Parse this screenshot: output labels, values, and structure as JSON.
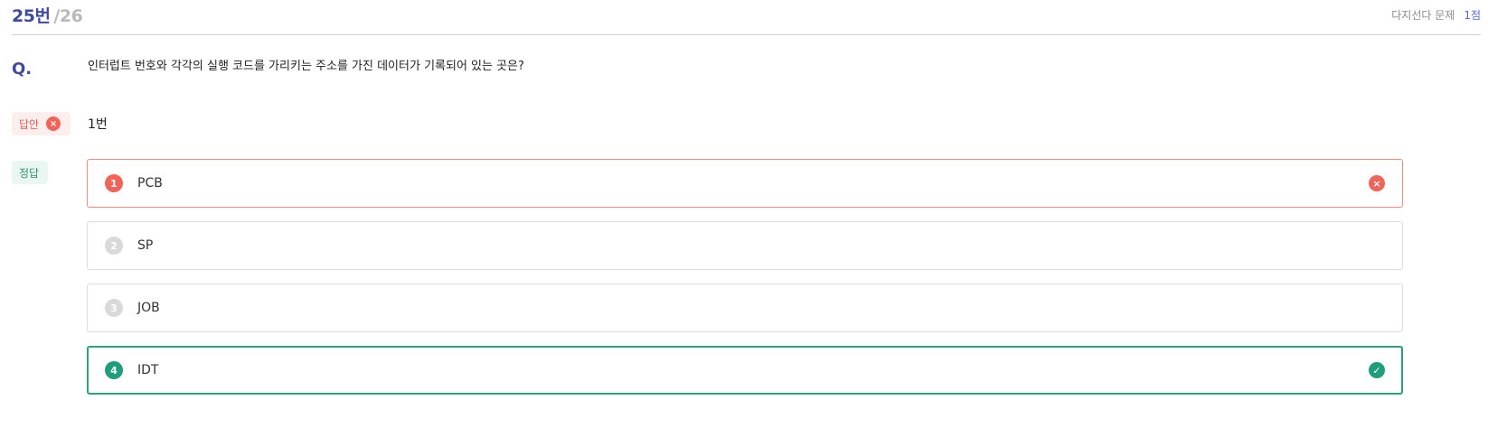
{
  "header": {
    "current": "25번",
    "total": "/26",
    "type": "다지선다 문제",
    "points": "1점"
  },
  "question": {
    "label": "Q.",
    "text": "인터럽트 번호와 각각의 실행 코드를 가리키는 주소를 가진 데이터가 기록되어 있는 곳은?"
  },
  "answer": {
    "label": "답안",
    "value": "1번",
    "status_icon": "close-circle-icon"
  },
  "correct": {
    "label": "정답"
  },
  "choices": [
    {
      "num": "1",
      "text": "PCB",
      "state": "wrong"
    },
    {
      "num": "2",
      "text": "SP",
      "state": "neutral"
    },
    {
      "num": "3",
      "text": "JOB",
      "state": "neutral"
    },
    {
      "num": "4",
      "text": "IDT",
      "state": "correct"
    }
  ],
  "icons": {
    "wrong": "×",
    "correct": "✓"
  },
  "colors": {
    "accent": "#3f4a9a",
    "wrong": "#f0645a",
    "correct": "#1f9e7b",
    "neutral": "#d9d9d9"
  }
}
